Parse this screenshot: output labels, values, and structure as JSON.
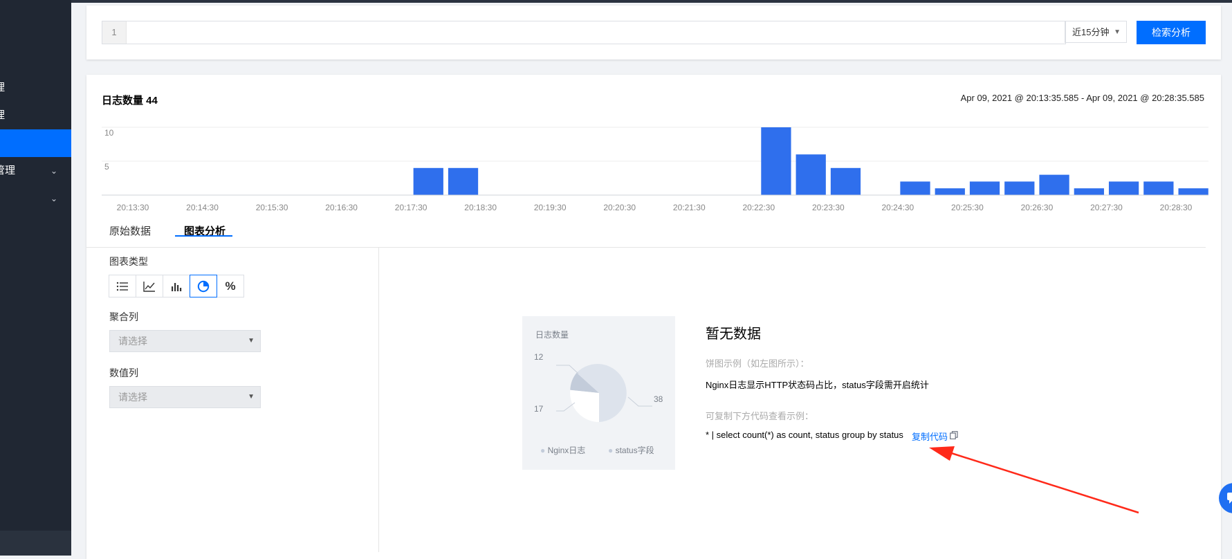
{
  "sidebar": {
    "items": [
      {
        "label": "理",
        "chevron": ""
      },
      {
        "label": "理",
        "chevron": ""
      },
      {
        "label": "",
        "chevron": ""
      },
      {
        "label": "管理",
        "chevron": "⌄"
      },
      {
        "label": "",
        "chevron": "⌄"
      }
    ]
  },
  "search": {
    "line_number": "1",
    "query_value": "",
    "time_range": "近15分钟",
    "submit_label": "检索分析"
  },
  "summary": {
    "log_count_label": "日志数量 44",
    "time_range_text": "Apr 09, 2021 @ 20:13:35.585 - Apr 09, 2021 @ 20:28:35.585"
  },
  "chart_data": {
    "type": "bar",
    "title": "",
    "xlabel": "",
    "ylabel": "",
    "ylim": [
      0,
      10
    ],
    "y_ticks": [
      "5",
      "10"
    ],
    "x_ticks": [
      "20:13:30",
      "20:14:30",
      "20:15:30",
      "20:16:30",
      "20:17:30",
      "20:18:30",
      "20:19:30",
      "20:20:30",
      "20:21:30",
      "20:22:30",
      "20:23:30",
      "20:24:30",
      "20:25:30",
      "20:26:30",
      "20:27:30",
      "20:28:30"
    ],
    "categories": [
      "20:13:30",
      "20:14:00",
      "20:14:30",
      "20:15:00",
      "20:15:30",
      "20:16:00",
      "20:16:30",
      "20:17:00",
      "20:17:30",
      "20:18:00",
      "20:18:30",
      "20:19:00",
      "20:19:30",
      "20:20:00",
      "20:20:30",
      "20:21:00",
      "20:21:30",
      "20:22:00",
      "20:22:30",
      "20:23:00",
      "20:23:30",
      "20:24:00",
      "20:24:30",
      "20:25:00",
      "20:25:30",
      "20:26:00",
      "20:26:30",
      "20:27:00",
      "20:27:30",
      "20:28:00",
      "20:28:30"
    ],
    "values": [
      0,
      0,
      0,
      0,
      0,
      0,
      0,
      0,
      4,
      4,
      0,
      0,
      0,
      0,
      0,
      0,
      0,
      0,
      10,
      6,
      4,
      0,
      2,
      1,
      2,
      2,
      3,
      1,
      2,
      2,
      1
    ],
    "grid": true,
    "color": "#2f6fed"
  },
  "tabs": [
    {
      "label": "原始数据"
    },
    {
      "label": "图表分析"
    }
  ],
  "panel": {
    "chart_type_label": "图表类型",
    "chart_types": [
      "list-icon",
      "line-chart-icon",
      "bar-chart-icon",
      "pie-chart-icon",
      "percent-icon"
    ],
    "aggregate_label": "聚合列",
    "aggregate_placeholder": "请选择",
    "value_label": "数值列",
    "value_placeholder": "请选择"
  },
  "example": {
    "title": "日志数量",
    "slice_labels": [
      "12",
      "17",
      "38"
    ],
    "legend": [
      "Nginx日志",
      "status字段"
    ]
  },
  "empty_state": {
    "title": "暂无数据",
    "hint": "饼图示例（如左图所示）：",
    "description": "Nginx日志显示HTTP状态码占比，status字段需开启统计",
    "copy_hint": "可复制下方代码查看示例：",
    "code": "* | select count(*) as count, status group by status",
    "copy_label": "复制代码"
  },
  "colors": {
    "accent": "#006eff",
    "bar": "#2f6fed",
    "sidebar": "#202733",
    "arrow": "#ff2a1a"
  }
}
